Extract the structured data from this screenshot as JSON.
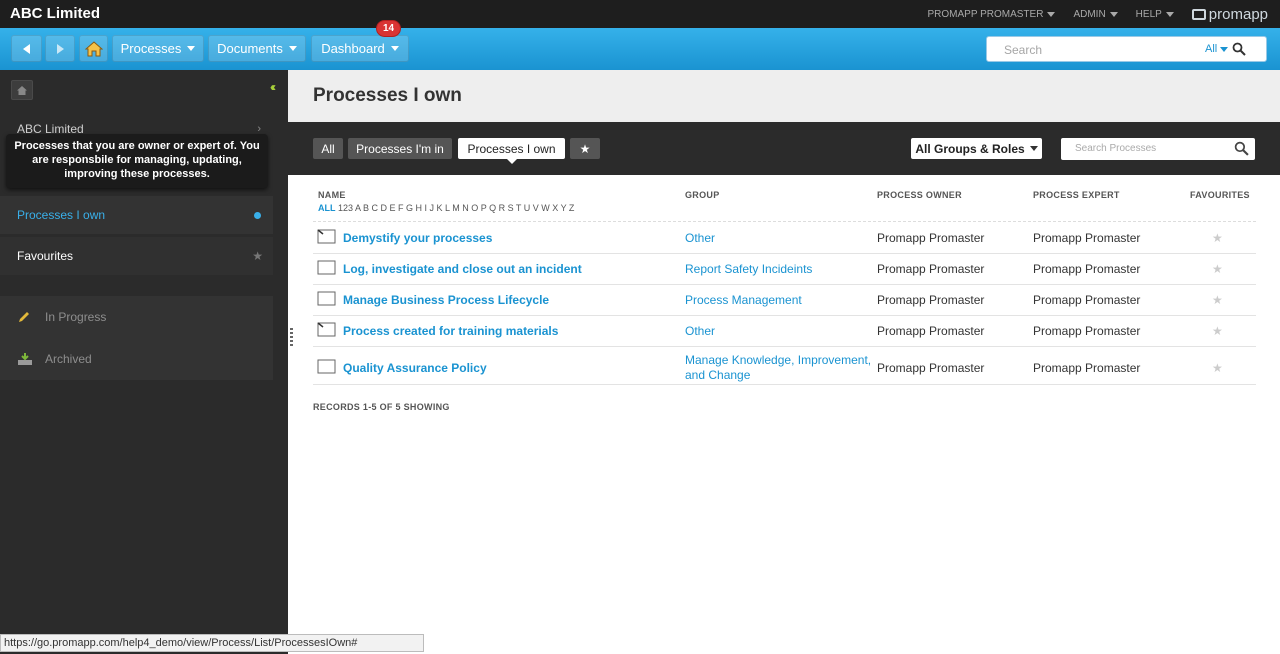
{
  "app": {
    "title": "ABC Limited",
    "logo_text": "promapp"
  },
  "top_links": [
    "PROMAPP PROMASTER",
    "ADMIN",
    "HELP"
  ],
  "nav": {
    "processes": "Processes",
    "documents": "Documents",
    "dashboard": "Dashboard",
    "dashboard_badge": "14"
  },
  "search": {
    "placeholder": "Search",
    "scope": "All"
  },
  "sidebar": {
    "org": "ABC Limited",
    "tooltip": "Processes that you are owner or expert of. You are responsbile for managing, updating, improving these processes.",
    "active_item": "Processes I own",
    "favourites": "Favourites",
    "in_progress": "In Progress",
    "archived": "Archived"
  },
  "page": {
    "title": "Processes I own"
  },
  "filters": {
    "all": "All",
    "im_in": "Processes I'm in",
    "i_own": "Processes I own",
    "groups_roles": "All Groups & Roles",
    "search_placeholder": "Search Processes"
  },
  "table": {
    "headers": {
      "name": "NAME",
      "group": "GROUP",
      "owner": "PROCESS OWNER",
      "expert": "PROCESS EXPERT",
      "favourites": "FAVOURITES"
    },
    "alpha_all": "ALL",
    "alpha_rest": "123 A B C D E F G H I J K L M N O P Q R S T U V W X Y Z",
    "rows": [
      {
        "name": "Demystify your processes",
        "group": "Other",
        "owner": "Promapp Promaster",
        "expert": "Promapp Promaster"
      },
      {
        "name": "Log, investigate and close out an incident",
        "group": "Report Safety Incideints",
        "owner": "Promapp Promaster",
        "expert": "Promapp Promaster"
      },
      {
        "name": "Manage Business Process Lifecycle",
        "group": "Process Management",
        "owner": "Promapp Promaster",
        "expert": "Promapp Promaster"
      },
      {
        "name": "Process created for training materials",
        "group": "Other",
        "owner": "Promapp Promaster",
        "expert": "Promapp Promaster"
      },
      {
        "name": "Quality Assurance Policy",
        "group_line1": "Manage Knowledge, Improvement,",
        "group_line2": "and Change",
        "owner": "Promapp Promaster",
        "expert": "Promapp Promaster"
      }
    ],
    "records": "RECORDS 1-5 OF 5 SHOWING"
  },
  "status_url": "https://go.promapp.com/help4_demo/view/Process/List/ProcessesIOwn#",
  "colors": {
    "accent": "#1a93d1",
    "topbar": "#1e1e1e",
    "sidebar": "#2b2b2b",
    "badge": "#d93434",
    "collapse": "#a7cf3a"
  }
}
